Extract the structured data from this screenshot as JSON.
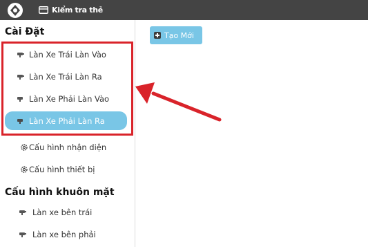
{
  "topbar": {
    "logo_icon": "compass-logo-icon",
    "card_check_icon": "card-icon",
    "card_check_label": "Kiểm tra thẻ"
  },
  "sidebar": {
    "section1_title": "Cài Đặt",
    "lanes": [
      {
        "label": "Làn Xe Trái Làn Vào",
        "icon": "camera-icon",
        "active": false
      },
      {
        "label": "Làn Xe Trái Làn Ra",
        "icon": "camera-icon",
        "active": false
      },
      {
        "label": "Làn Xe Phải Làn Vào",
        "icon": "camera-icon",
        "active": false
      },
      {
        "label": "Làn Xe Phải Làn Ra",
        "icon": "camera-icon",
        "active": true
      }
    ],
    "config": [
      {
        "label": "Cấu hình nhận diện",
        "icon": "gear-icon"
      },
      {
        "label": "Cấu hình thiết bị",
        "icon": "gear-icon"
      }
    ],
    "section2_title": "Cấu hình khuôn mặt",
    "face_lanes": [
      {
        "label": "Làn xe bên trái",
        "icon": "camera-icon"
      },
      {
        "label": "Làn xe bên phải",
        "icon": "camera-icon"
      }
    ]
  },
  "main": {
    "new_button_label": "Tạo Mới",
    "new_button_icon": "plus-square-icon"
  },
  "colors": {
    "topbar": "#444444",
    "accent": "#79c6e6",
    "highlight": "#d9232a"
  }
}
